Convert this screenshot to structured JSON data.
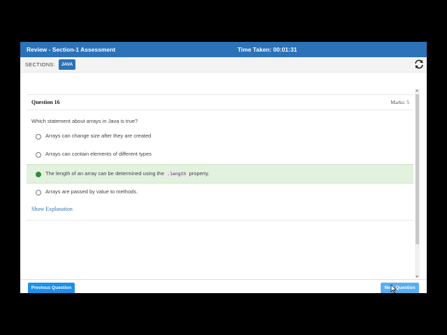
{
  "header": {
    "title": "Review - Section-1 Assessment",
    "timer": "Time Taken: 00:01:31"
  },
  "sections": {
    "label": "SECTIONS:",
    "chip": "JAVA",
    "refresh_icon": "refresh-icon"
  },
  "question": {
    "number": "Question 16",
    "marks": "Marks: 5",
    "text": "Which statement about arrays in Java is true?",
    "options": [
      {
        "text": "Arrays can change size after they are created",
        "selected": false
      },
      {
        "text": "Arrays can contain elements of different types",
        "selected": false
      },
      {
        "text_before": "The length of an array can be determined using the",
        "code": ".length",
        "text_after": "property.",
        "selected": true
      },
      {
        "text": "Arrays are passed by value to methods.",
        "selected": false
      }
    ],
    "show_explanation": "Show Explanation"
  },
  "footer": {
    "prev_label": "Previous Question",
    "next_label": "Next Question"
  },
  "colors": {
    "header_bg": "#2b72b8",
    "correct_bg": "#e2f2df",
    "button_bg": "#1e90e8"
  }
}
